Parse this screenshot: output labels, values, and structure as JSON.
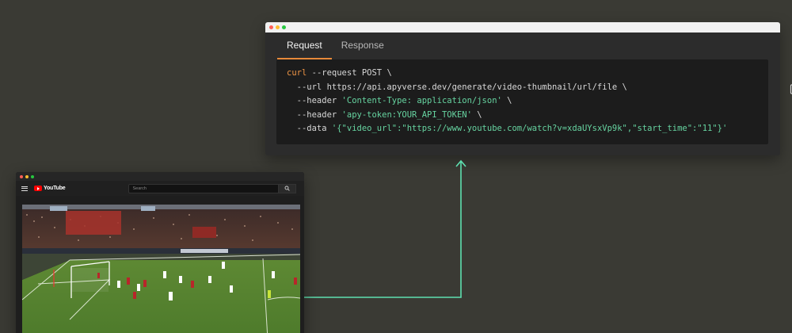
{
  "api_window": {
    "tabs": [
      {
        "label": "Request",
        "active": true
      },
      {
        "label": "Response",
        "active": false
      }
    ],
    "code": {
      "line1": {
        "cmd": "curl",
        "rest": " --request POST \\"
      },
      "line2": {
        "text": "  --url https://api.apyverse.dev/generate/video-thumbnail/url/file \\"
      },
      "line3": {
        "prefix": "  --header ",
        "string": "'Content-Type: application/json'",
        "suffix": " \\"
      },
      "line4": {
        "prefix": "  --header ",
        "string": "'apy-token:YOUR_API_TOKEN'",
        "suffix": " \\"
      },
      "line5": {
        "prefix": "  --data ",
        "string": "'{\"video_url\":\"https://www.youtube.com/watch?v=xdaUYsxVp9k\",\"start_time\":\"11\"}'"
      }
    },
    "copy_icon": "clipboard-icon"
  },
  "browser": {
    "logo_text": "YouTube",
    "search_placeholder": "Search",
    "search_icon": "search-icon",
    "menu_icon": "hamburger-menu-icon"
  },
  "colors": {
    "background": "#3a3a34",
    "accent_tab": "#e88a3a",
    "code_keyword": "#ef9545",
    "code_string": "#66d3a0",
    "connector": "#5ee0b0"
  }
}
